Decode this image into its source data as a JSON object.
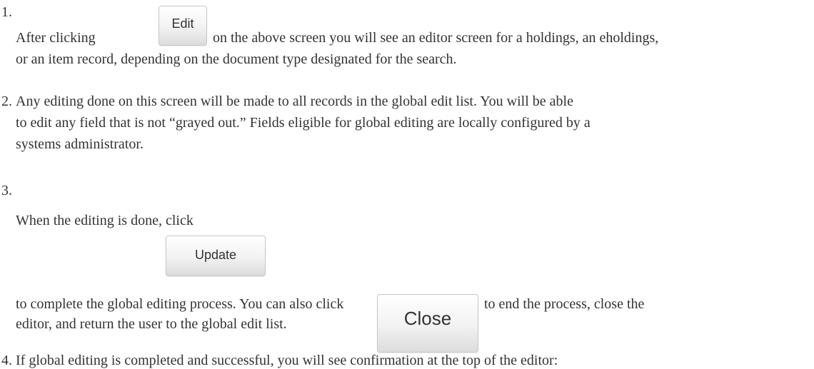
{
  "items": [
    {
      "number": "1.",
      "line1_before": "After clicking",
      "line1_after": "on the above screen you will see an editor screen for a holdings, an eholdings,",
      "line2": "or an item record, depending on the document type designated for the search.",
      "button_label": "Edit"
    },
    {
      "number": "2.",
      "line1": "Any editing done on this screen will be made to all records in the global edit list. You will be able",
      "line2": "to edit any field that is not “grayed out.” Fields eligible for global editing are locally configured by a",
      "line3": "systems administrator."
    },
    {
      "number": "3.",
      "line1_before": "When the editing is done, click",
      "update_button_label": "Update",
      "line2_before": "to complete the global editing process. You can also click",
      "close_button_label": "Close",
      "line2_after": "to end the process, close the",
      "line3": "editor, and return the user to the global edit list."
    },
    {
      "number": "4.",
      "line1": "If global editing is completed and successful, you will see confirmation at the top of the editor:"
    }
  ]
}
